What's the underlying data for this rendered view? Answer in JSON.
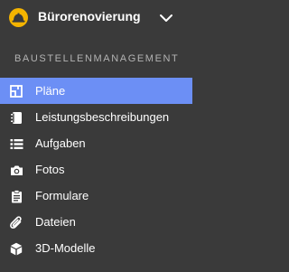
{
  "project": {
    "title": "Bürorenovierung",
    "logo_icon": "hardhat-icon",
    "toggle_icon": "chevron-down-icon",
    "logo_color": "#f4b400"
  },
  "section": {
    "heading": "BAUSTELLENMANAGEMENT"
  },
  "nav": {
    "active_color": "#6c8ff5",
    "items": [
      {
        "label": "Pläne",
        "icon": "floorplan-icon",
        "active": true
      },
      {
        "label": "Leistungsbeschreibungen",
        "icon": "notebook-icon",
        "active": false
      },
      {
        "label": "Aufgaben",
        "icon": "list-icon",
        "active": false
      },
      {
        "label": "Fotos",
        "icon": "camera-icon",
        "active": false
      },
      {
        "label": "Formulare",
        "icon": "clipboard-icon",
        "active": false
      },
      {
        "label": "Dateien",
        "icon": "paperclip-icon",
        "active": false
      },
      {
        "label": "3D-Modelle",
        "icon": "cube-icon",
        "active": false
      }
    ]
  }
}
